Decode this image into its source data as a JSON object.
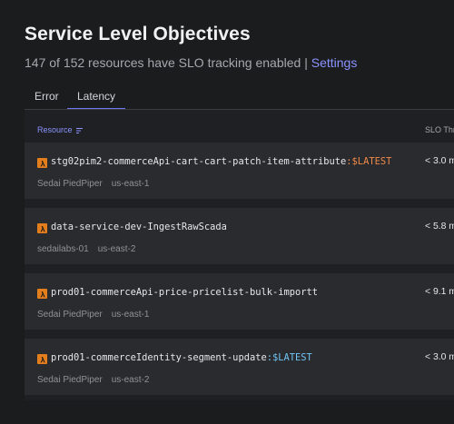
{
  "page": {
    "title": "Service Level Objectives",
    "subtitle": "147 of 152 resources have SLO tracking enabled |",
    "settings_link": "Settings"
  },
  "tabs": [
    {
      "label": "Error",
      "active": false
    },
    {
      "label": "Latency",
      "active": true
    }
  ],
  "table": {
    "headers": {
      "resource": "Resource",
      "slo_threshold": "SLO Thr"
    },
    "rows": [
      {
        "name": "stg02pim2-commerceApi-cart-cart-patch-item-attribute",
        "suffix": ":$LATEST",
        "suffix_color": "orange",
        "account": "Sedai PiedPiper",
        "region": "us-east-1",
        "threshold": "< 3.0 m"
      },
      {
        "name": "data-service-dev-IngestRawScada",
        "suffix": "",
        "suffix_color": "",
        "account": "sedailabs-01",
        "region": "us-east-2",
        "threshold": "< 5.8 m"
      },
      {
        "name": "prod01-commerceApi-price-pricelist-bulk-importt",
        "suffix": "",
        "suffix_color": "",
        "account": "Sedai PiedPiper",
        "region": "us-east-1",
        "threshold": "< 9.1 m"
      },
      {
        "name": "prod01-commerceIdentity-segment-update",
        "suffix": ":$LATEST",
        "suffix_color": "blue",
        "account": "Sedai PiedPiper",
        "region": "us-east-2",
        "threshold": "< 3.0 m"
      }
    ]
  },
  "colors": {
    "accent": "#8a93ff",
    "lambda_orange": "#e47d1b",
    "suffix_orange": "#f0894a",
    "suffix_blue": "#6fc4f2"
  },
  "icons": {
    "resource_type": "aws-lambda-icon",
    "sort": "sort-icon"
  }
}
